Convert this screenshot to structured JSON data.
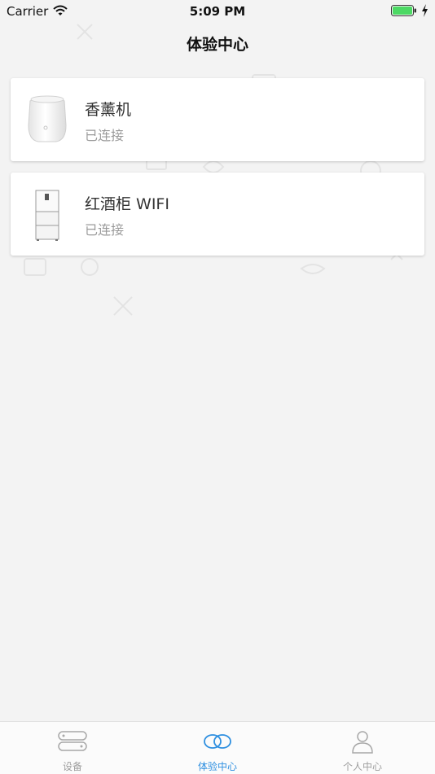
{
  "status_bar": {
    "carrier": "Carrier",
    "time": "5:09 PM",
    "icons": [
      "wifi-icon",
      "battery-icon",
      "charging-icon"
    ]
  },
  "nav": {
    "title": "体验中心"
  },
  "devices": [
    {
      "name": "香薰机",
      "status": "已连接",
      "icon": "aroma-diffuser-icon"
    },
    {
      "name": "红酒柜 WIFI",
      "status": "已连接",
      "icon": "wine-cabinet-icon"
    }
  ],
  "tabs": [
    {
      "label": "设备",
      "icon": "devices-icon",
      "active": false
    },
    {
      "label": "体验中心",
      "icon": "experience-rings-icon",
      "active": true
    },
    {
      "label": "个人中心",
      "icon": "person-icon",
      "active": false
    }
  ],
  "colors": {
    "accent": "#2e8fe0",
    "background": "#f3f3f3",
    "battery": "#4cd964",
    "inactive_tab": "#9e9e9e"
  }
}
